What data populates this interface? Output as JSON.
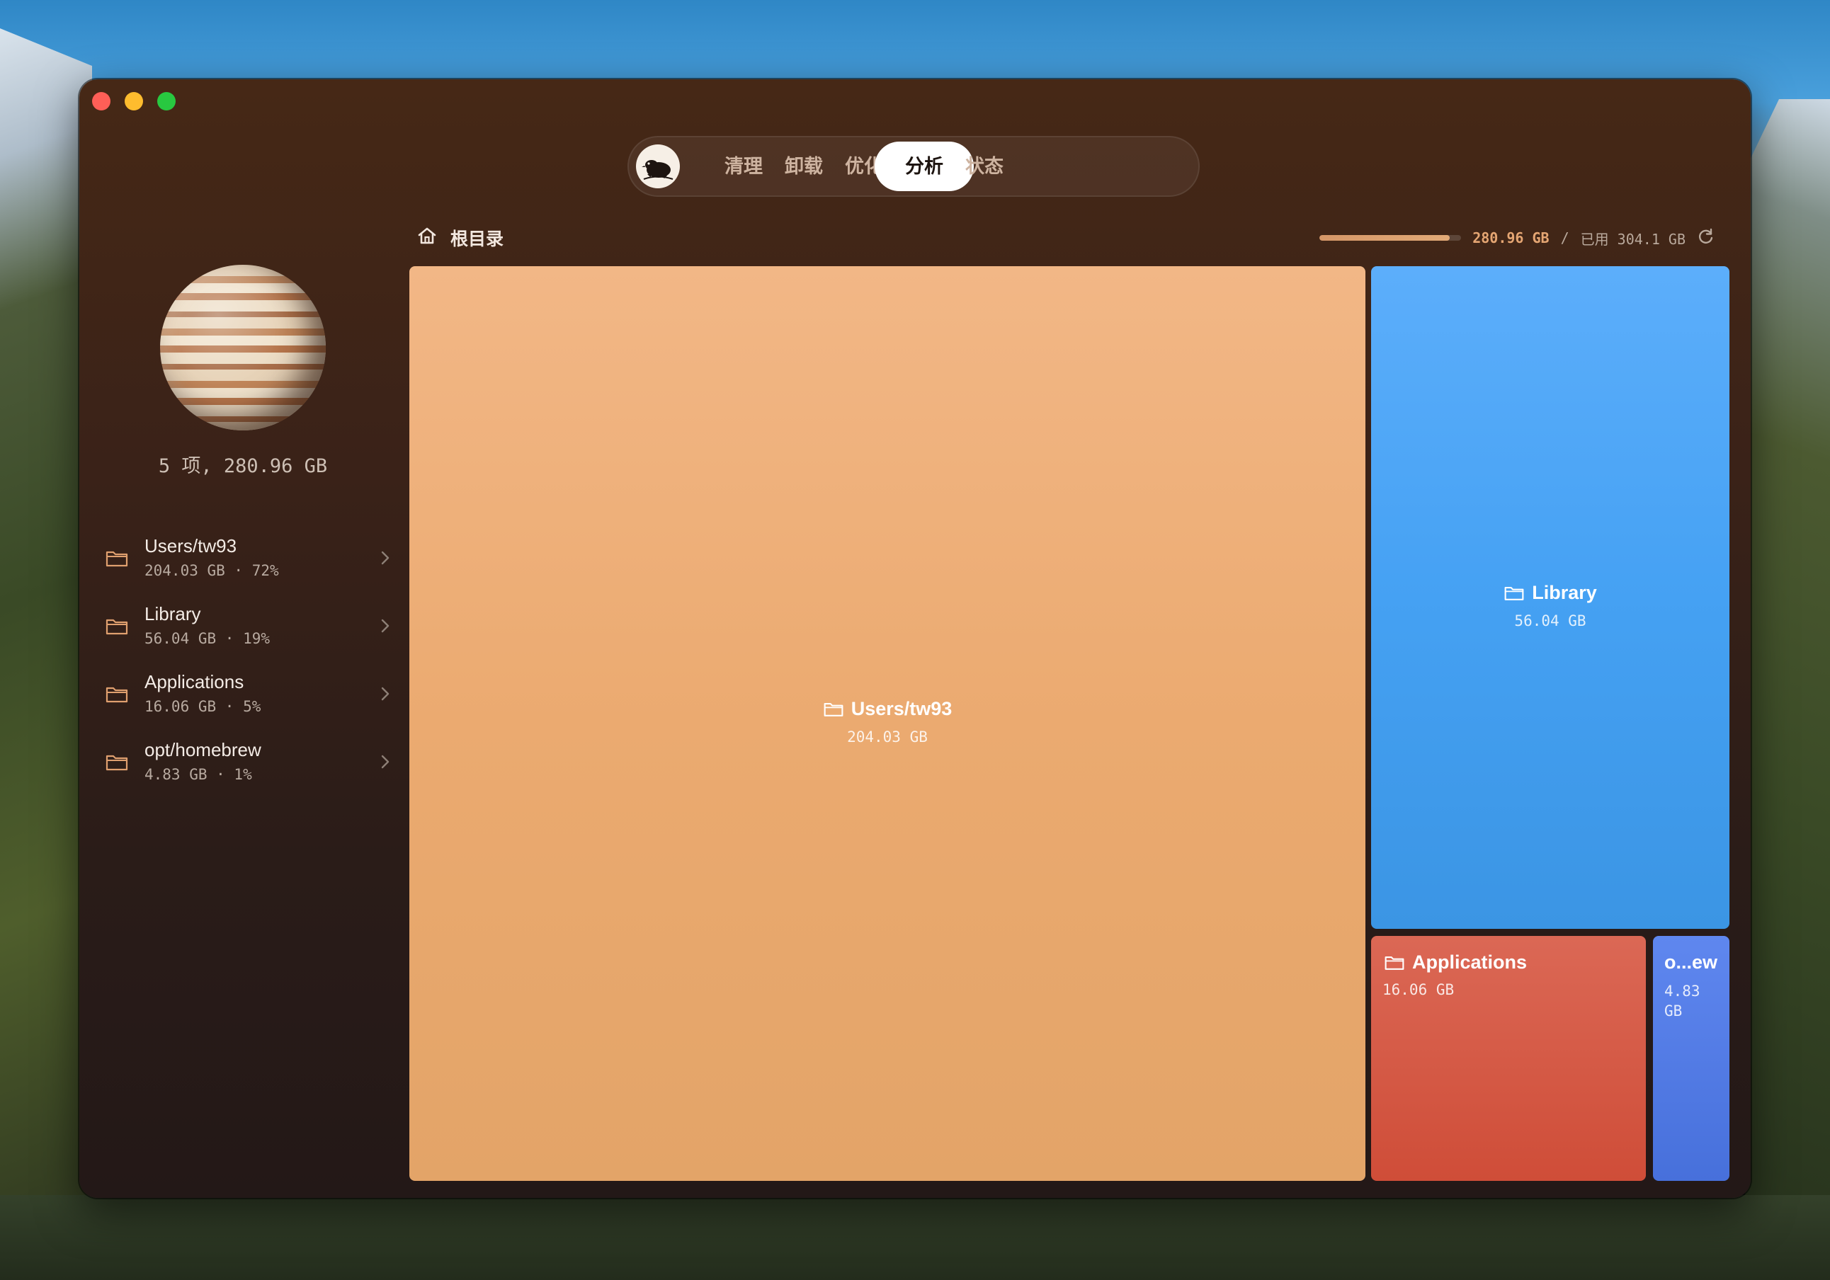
{
  "tabs": {
    "logo_icon": "mole-icon",
    "items": [
      {
        "label": "清理",
        "active": false
      },
      {
        "label": "卸载",
        "active": false
      },
      {
        "label": "优化",
        "active": false
      },
      {
        "label": "分析",
        "active": true
      },
      {
        "label": "状态",
        "active": false
      }
    ]
  },
  "breadcrumb": {
    "icon": "home-icon",
    "label": "根目录"
  },
  "usage": {
    "used": "280.96 GB",
    "separator": "/",
    "total_label": "已用 304.1 GB",
    "fill_fraction": 0.92,
    "refresh_icon": "refresh-icon"
  },
  "sidebar": {
    "planet_icon": "planet-icon",
    "summary": "5 项, 280.96 GB",
    "items": [
      {
        "name": "Users/tw93",
        "meta": "204.03 GB · 72%"
      },
      {
        "name": "Library",
        "meta": "56.04 GB · 19%"
      },
      {
        "name": "Applications",
        "meta": "16.06 GB · 5%"
      },
      {
        "name": "opt/homebrew",
        "meta": "4.83 GB · 1%"
      }
    ]
  },
  "treemap": {
    "tiles": [
      {
        "name": "Users/tw93",
        "size": "204.03 GB",
        "color": "#eeae78"
      },
      {
        "name": "Library",
        "size": "56.04 GB",
        "color": "#48a3f5"
      },
      {
        "name": "Applications",
        "size": "16.06 GB",
        "color": "#d45a45"
      },
      {
        "name": "o...ew",
        "size": "4.83 GB",
        "color": "#537be4"
      }
    ]
  },
  "colors": {
    "window_bg": "#3a2218",
    "accent": "#e5a673",
    "active_tab_bg": "#ffffff"
  }
}
